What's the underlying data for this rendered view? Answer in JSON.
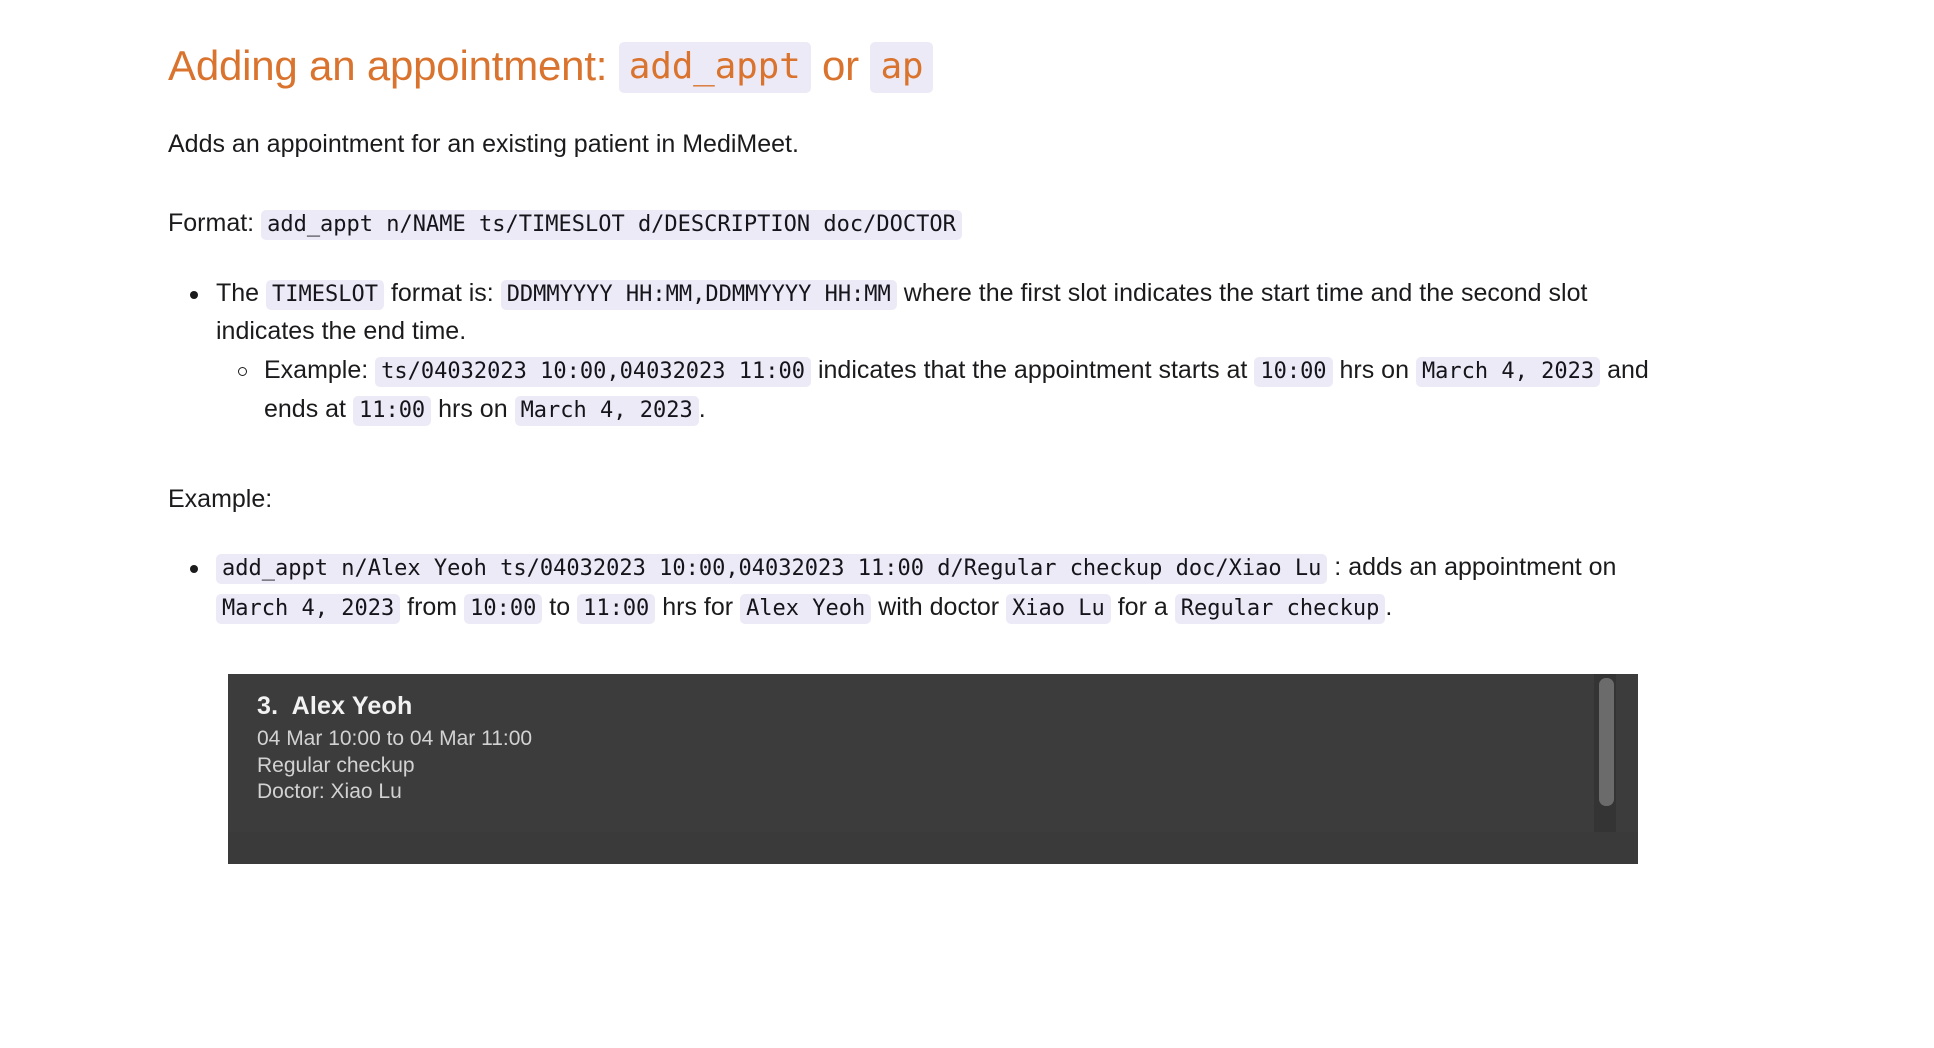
{
  "heading": {
    "text_before": "Adding an appointment: ",
    "code_1": "add_appt",
    "text_middle": " or ",
    "code_2": "ap"
  },
  "intro": "Adds an appointment for an existing patient in MediMeet.",
  "format": {
    "label": "Format: ",
    "code": "add_appt n/NAME ts/TIMESLOT d/DESCRIPTION doc/DOCTOR"
  },
  "timeslot_bullet": {
    "t1": "The ",
    "code_timeslot": "TIMESLOT",
    "t2": " format is: ",
    "code_format": "DDMMYYYY HH:MM,DDMMYYYY HH:MM",
    "t3": " where the first slot indicates the start time and the second slot indicates the end time.",
    "sub": {
      "s1": "Example: ",
      "code_ts": "ts/04032023 10:00,04032023 11:00",
      "s2": " indicates that the appointment starts at ",
      "code_start_time": "10:00",
      "s3": " hrs on ",
      "code_start_date": "March 4, 2023",
      "s4": " and ends at ",
      "code_end_time": "11:00",
      "s5": " hrs on ",
      "code_end_date": "March 4, 2023",
      "s6": "."
    }
  },
  "example_label": "Example:",
  "example_bullet": {
    "code_command": "add_appt n/Alex Yeoh ts/04032023 10:00,04032023 11:00 d/Regular checkup doc/Xiao Lu",
    "e1": " : adds an appointment on ",
    "code_date": "March 4, 2023",
    "e2": " from ",
    "code_from": "10:00",
    "e3": " to ",
    "code_to": "11:00",
    "e4": " hrs for ",
    "code_patient": "Alex Yeoh",
    "e5": " with doctor ",
    "code_doctor": "Xiao Lu",
    "e6": " for a ",
    "code_desc": "Regular checkup",
    "e7": "."
  },
  "screenshot": {
    "title": "3.  Alex Yeoh",
    "time_range": "04 Mar 10:00 to 04 Mar 11:00",
    "description": "Regular checkup",
    "doctor": "Doctor: Xiao Lu"
  },
  "colors": {
    "heading": "#d9732d",
    "code_background": "#eceaf6",
    "body_text": "#1b1b1d",
    "page_background": "#ffffff",
    "screenshot_background": "#3c3c3c",
    "screenshot_title": "#f2f2f2",
    "screenshot_text": "#d2d2d2",
    "scrollbar_thumb": "#6b6b6b"
  }
}
